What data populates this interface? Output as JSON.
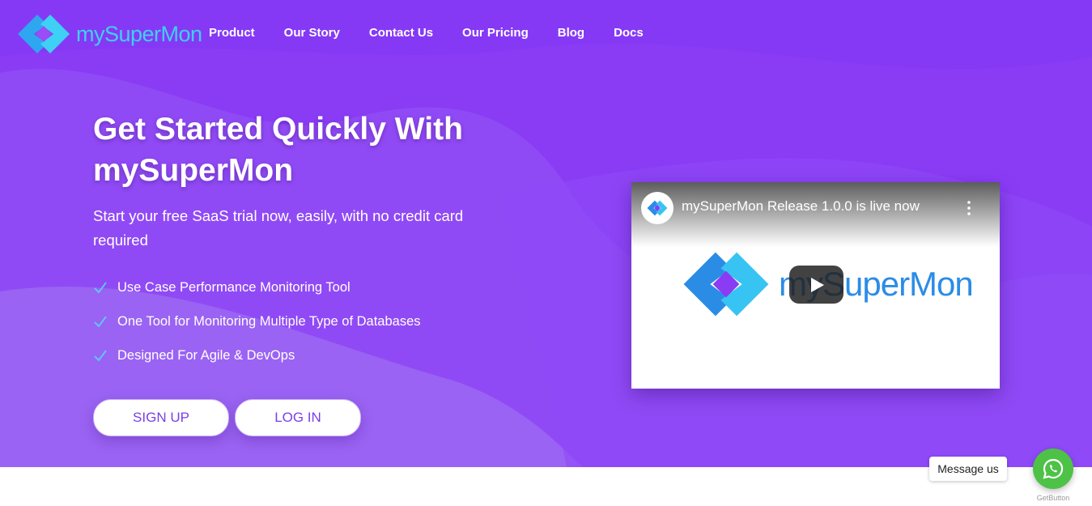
{
  "brand": {
    "name": "mySuperMon"
  },
  "nav": {
    "items": [
      "Product",
      "Our Story",
      "Contact Us",
      "Our Pricing",
      "Blog",
      "Docs"
    ]
  },
  "hero": {
    "headline": "Get Started Quickly With mySuperMon",
    "subtext": "Start your free SaaS trial now, easily, with no credit card required",
    "features": [
      "Use Case Performance Monitoring Tool",
      "One Tool for Monitoring Multiple Type of Databases",
      "Designed For Agile & DevOps"
    ],
    "signup_label": "SIGN UP",
    "login_label": "LOG IN"
  },
  "video": {
    "title": "mySuperMon Release 1.0.0 is live now",
    "logo_text": "mySuperMon"
  },
  "chat": {
    "message_label": "Message us",
    "powered_by": "GetButton"
  },
  "colors": {
    "hero_bg": "#8a3cf5",
    "accent": "#7a3fe8",
    "logo_cyan": "#3fd0f5",
    "whatsapp": "#4dc247"
  },
  "icons": {
    "check": "check-icon",
    "play": "play-icon",
    "whatsapp": "whatsapp-icon",
    "more": "more-vertical-icon"
  }
}
